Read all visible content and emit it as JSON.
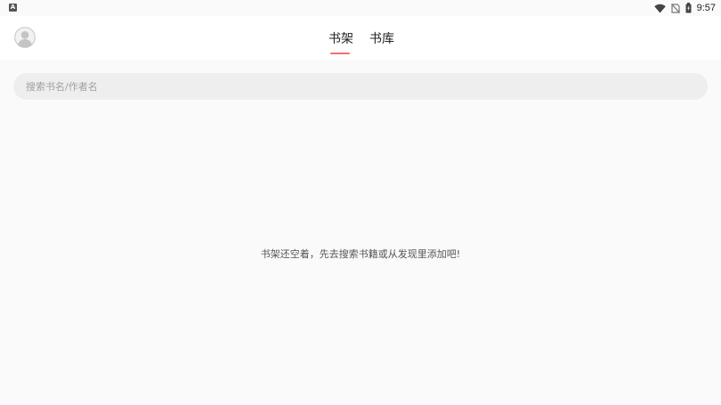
{
  "status_bar": {
    "left_icon_letter": "A",
    "time": "9:57",
    "icons": [
      "wifi-icon",
      "no-sim-icon",
      "battery-icon"
    ]
  },
  "header": {
    "avatar_icon": "user-avatar-icon",
    "tabs": [
      {
        "label": "书架",
        "active": true
      },
      {
        "label": "书库",
        "active": false
      }
    ],
    "accent_color": "#f06f6f"
  },
  "search": {
    "placeholder": "搜索书名/作者名",
    "value": ""
  },
  "shelf": {
    "empty_message": "书架还空着，先去搜索书籍或从发现里添加吧!"
  }
}
